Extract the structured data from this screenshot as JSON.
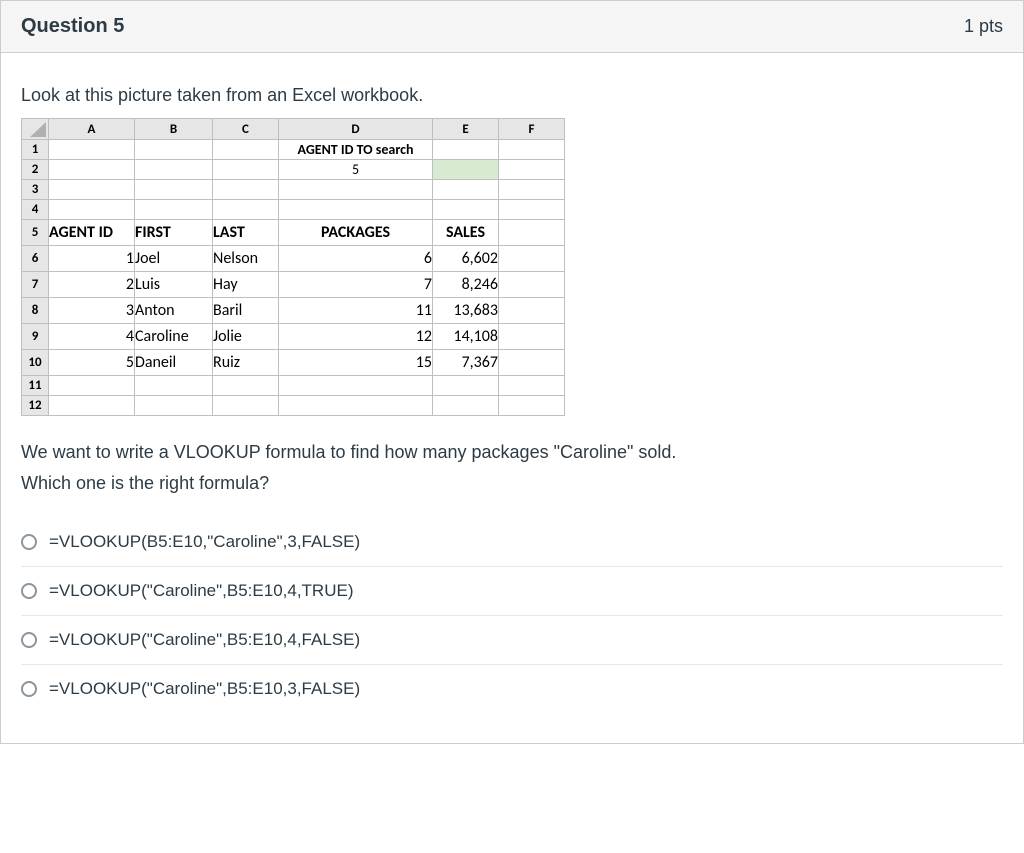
{
  "header": {
    "title": "Question 5",
    "points": "1 pts"
  },
  "prompt": {
    "line1": "Look at this picture taken from an Excel workbook.",
    "line2": "We want to write a VLOOKUP formula to find how many packages \"Caroline\" sold.",
    "line3": "Which one is the right formula?"
  },
  "excel": {
    "columns": [
      "A",
      "B",
      "C",
      "D",
      "E",
      "F"
    ],
    "row_numbers": [
      "1",
      "2",
      "3",
      "4",
      "5",
      "6",
      "7",
      "8",
      "9",
      "10",
      "11",
      "12"
    ],
    "D1": "AGENT ID TO search",
    "D2": "5",
    "headers5": {
      "A": "AGENT ID",
      "B": "FIRST",
      "C": "LAST",
      "D": "PACKAGES",
      "E": "SALES"
    },
    "rows": [
      {
        "id": "1",
        "first": "Joel",
        "last": "Nelson",
        "packages": "6",
        "sales": "6,602"
      },
      {
        "id": "2",
        "first": "Luis",
        "last": "Hay",
        "packages": "7",
        "sales": "8,246"
      },
      {
        "id": "3",
        "first": "Anton",
        "last": "Baril",
        "packages": "11",
        "sales": "13,683"
      },
      {
        "id": "4",
        "first": "Caroline",
        "last": "Jolie",
        "packages": "12",
        "sales": "14,108"
      },
      {
        "id": "5",
        "first": "Daneil",
        "last": "Ruiz",
        "packages": "15",
        "sales": "7,367"
      }
    ]
  },
  "answers": [
    "=VLOOKUP(B5:E10,\"Caroline\",3,FALSE)",
    "=VLOOKUP(\"Caroline\",B5:E10,4,TRUE)",
    "=VLOOKUP(\"Caroline\",B5:E10,4,FALSE)",
    "=VLOOKUP(\"Caroline\",B5:E10,3,FALSE)"
  ]
}
